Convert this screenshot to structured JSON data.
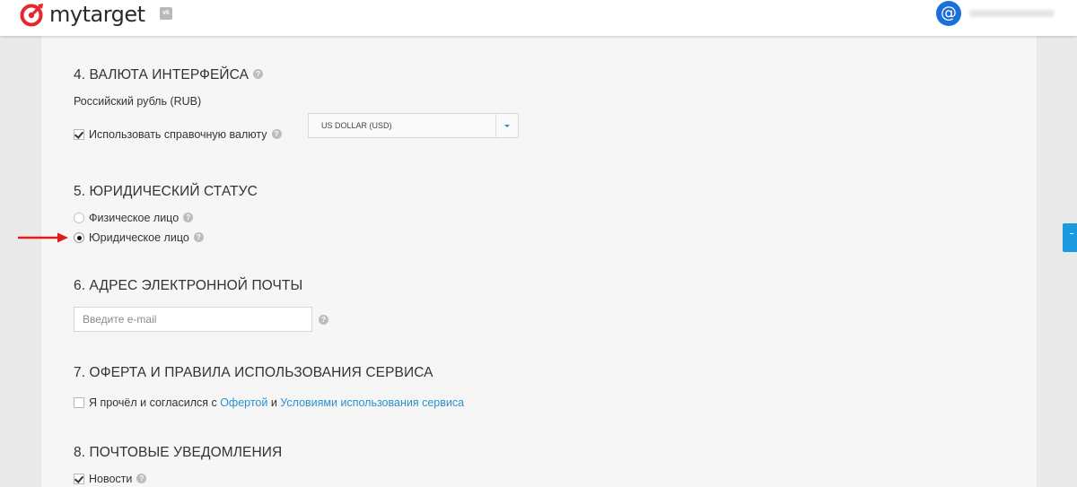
{
  "header": {
    "brand": "mytarget",
    "vk_badge": "vk",
    "avatar_symbol": "@"
  },
  "section4": {
    "title": "4. ВАЛЮТА ИНТЕРФЕЙСА",
    "currency": "Российский рубль (RUB)",
    "reference_checkbox_label": "Использовать справочную валюту",
    "reference_checked": true,
    "select_value": "US DOLLAR (USD)"
  },
  "section5": {
    "title": "5. ЮРИДИЧЕСКИЙ СТАТУС",
    "options": [
      {
        "label": "Физическое лицо",
        "selected": false
      },
      {
        "label": "Юридическое лицо",
        "selected": true
      }
    ]
  },
  "section6": {
    "title": "6. АДРЕС ЭЛЕКТРОННОЙ ПОЧТЫ",
    "email_placeholder": "Введите e-mail",
    "email_value": ""
  },
  "section7": {
    "title": "7. ОФЕРТА И ПРАВИЛА ИСПОЛЬЗОВАНИЯ СЕРВИСА",
    "agree_prefix": "Я прочёл и согласился с ",
    "offer_link": "Офертой",
    "and": " и ",
    "terms_link": "Условиями использования сервиса",
    "agree_checked": false
  },
  "section8": {
    "title": "8. ПОЧТОВЫЕ УВЕДОМЛЕНИЯ",
    "news_label": "Новости",
    "news_checked": true
  },
  "help_glyph": "?",
  "colors": {
    "link": "#2a91cf",
    "brand_red": "#e8262f",
    "avatar_blue": "#1a6fd8",
    "side_tab_blue": "#1a9be0",
    "arrow_red": "#e01b1b"
  }
}
